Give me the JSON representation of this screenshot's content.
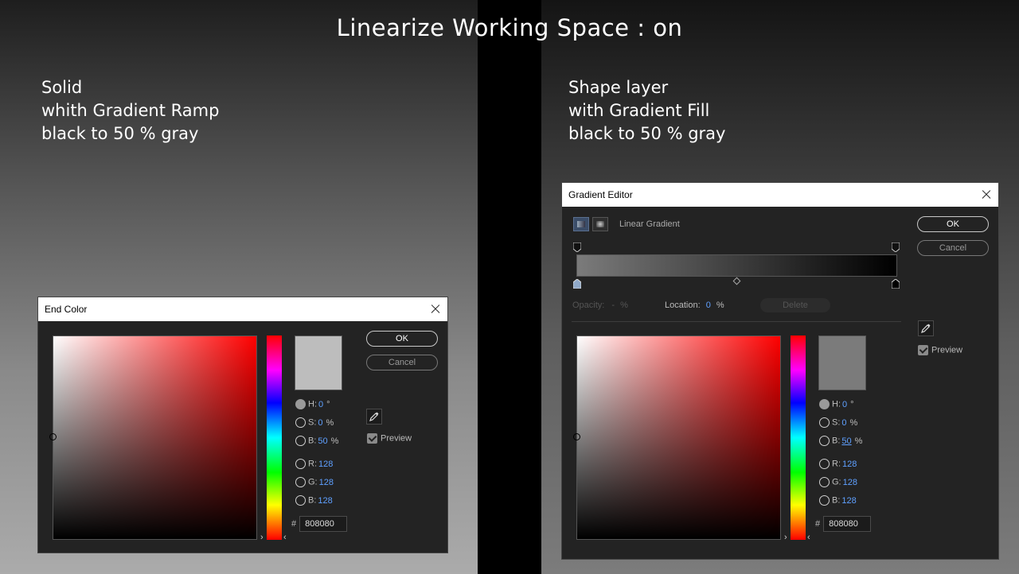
{
  "header": {
    "title": "Linearize Working Space : on"
  },
  "left_caption": {
    "lines": [
      "Solid",
      "whith Gradient Ramp",
      "black to 50 % gray"
    ]
  },
  "right_caption": {
    "lines": [
      "Shape layer",
      "with Gradient Fill",
      "black to 50 % gray"
    ]
  },
  "end_color_dialog": {
    "title": "End Color",
    "ok_label": "OK",
    "cancel_label": "Cancel",
    "swatch_color": "#bdbdbd",
    "fields": {
      "h": {
        "label": "H:",
        "value": "0",
        "unit": "°"
      },
      "s": {
        "label": "S:",
        "value": "0",
        "unit": "%"
      },
      "b": {
        "label": "B:",
        "value": "50",
        "unit": "%"
      },
      "r": {
        "label": "R:",
        "value": "128"
      },
      "g": {
        "label": "G:",
        "value": "128"
      },
      "b2": {
        "label": "B:",
        "value": "128"
      }
    },
    "hex_label": "#",
    "hex_value": "808080",
    "preview_label": "Preview",
    "preview_checked": true
  },
  "gradient_editor_dialog": {
    "title": "Gradient Editor",
    "gradient_type_label": "Linear Gradient",
    "ok_label": "OK",
    "cancel_label": "Cancel",
    "opacity_label": "Opacity:",
    "opacity_value": "-",
    "opacity_unit": "%",
    "location_label": "Location:",
    "location_value": "0",
    "location_unit": "%",
    "delete_label": "Delete",
    "swatch_color": "#7b7b7b",
    "fields": {
      "h": {
        "label": "H:",
        "value": "0",
        "unit": "°"
      },
      "s": {
        "label": "S:",
        "value": "0",
        "unit": "%"
      },
      "b": {
        "label": "B:",
        "value": "50",
        "unit": "%"
      },
      "r": {
        "label": "R:",
        "value": "128"
      },
      "g": {
        "label": "G:",
        "value": "128"
      },
      "b2": {
        "label": "B:",
        "value": "128"
      }
    },
    "hex_label": "#",
    "hex_value": "808080",
    "preview_label": "Preview",
    "preview_checked": true
  },
  "colors": {
    "accent_value": "#5fa0ff",
    "gradient_start": "#7b7b7b",
    "gradient_end": "#000000"
  }
}
